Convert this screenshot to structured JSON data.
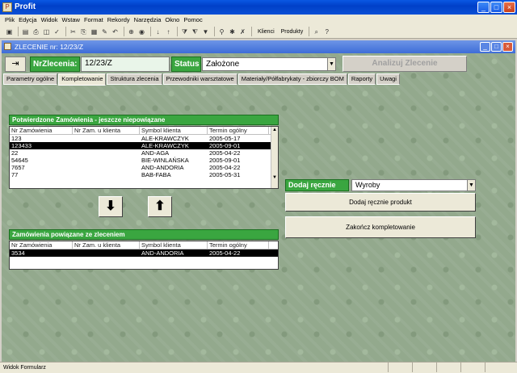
{
  "app": {
    "title": "Profit"
  },
  "menu": [
    "Plik",
    "Edycja",
    "Widok",
    "Wstaw",
    "Format",
    "Rekordy",
    "Narzędzia",
    "Okno",
    "Pomoc"
  ],
  "toolbar": {
    "klienci_label": "Klienci",
    "produkty_label": "Produkty"
  },
  "window": {
    "title": "ZLECENIE nr: 12/23/Z"
  },
  "header": {
    "nr_label": "NrZlecenia:",
    "nr_value": "12/23/Z",
    "status_label": "Status",
    "status_value": "Założone",
    "analyze_button": "Analizuj Zlecenie"
  },
  "tabs": [
    "Parametry ogólne",
    "Kompletowanie",
    "Struktura zlecenia",
    "Przewodniki warsztatowe",
    "Materiały/Półfabrykaty - zbiorczy BOM",
    "Raporty",
    "Uwagi"
  ],
  "confirmed": {
    "title": "Potwierdzone Zamówienia - jeszcze niepowiązane",
    "columns": [
      "Nr Zamówienia",
      "Nr Zam. u klienta",
      "Symbol klienta",
      "Termin ogólny"
    ],
    "rows": [
      [
        "123",
        "",
        "ALE-KRAWCZYK",
        "2005-05-17"
      ],
      [
        "123433",
        "",
        "ALE-KRAWCZYK",
        "2005-09-01"
      ],
      [
        "22",
        "",
        "AND-AGA",
        "2005-04-22"
      ],
      [
        "54645",
        "",
        "BIE-WINLAŃSKA",
        "2005-09-01"
      ],
      [
        "7657",
        "",
        "AND-ANDORIA",
        "2005-04-22"
      ],
      [
        "77",
        "",
        "BAB-FABA",
        "2005-05-31"
      ]
    ],
    "selected_row": 1
  },
  "linked": {
    "title": "Zamówienia powiązane ze zleceniem",
    "columns": [
      "Nr Zamówienia",
      "Nr Zam. u klienta",
      "Symbol klienta",
      "Termin ogólny"
    ],
    "rows": [
      [
        "3534",
        "",
        "AND-ANDORIA",
        "2005-04-22"
      ]
    ]
  },
  "manual": {
    "label": "Dodaj ręcznie",
    "select_value": "Wyroby",
    "add_product_button": "Dodaj ręcznie produkt",
    "finish_button": "Zakończ kompletowanie"
  },
  "statusbar": {
    "text": "Widok Formularz"
  }
}
